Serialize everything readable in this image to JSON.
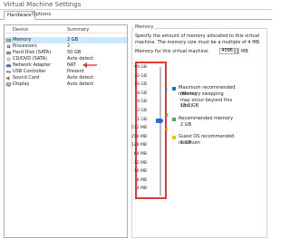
{
  "window": {
    "title": "Virtual Machine Settings"
  },
  "tabs": [
    {
      "label": "Hardware"
    },
    {
      "label": "Options"
    }
  ],
  "devices": {
    "header": {
      "device": "Device",
      "summary": "Summary"
    },
    "items": [
      {
        "name": "Memory",
        "summary": "2 GB",
        "icon": "memory-icon"
      },
      {
        "name": "Processors",
        "summary": "2",
        "icon": "processor-icon"
      },
      {
        "name": "Hard Disk (SATA)",
        "summary": "50 GB",
        "icon": "hard-disk-icon"
      },
      {
        "name": "CD/DVD (SATA)",
        "summary": "Auto detect",
        "icon": "cd-dvd-icon"
      },
      {
        "name": "Network Adapter",
        "summary": "NAT",
        "icon": "network-adapter-icon"
      },
      {
        "name": "USB Controller",
        "summary": "Present",
        "icon": "usb-icon"
      },
      {
        "name": "Sound Card",
        "summary": "Auto detect",
        "icon": "sound-card-icon"
      },
      {
        "name": "Display",
        "summary": "Auto detect",
        "icon": "display-icon"
      }
    ]
  },
  "memory": {
    "group_label": "Memory",
    "description": "Specify the amount of memory allocated to this virtual machine. The memory size must be a multiple of 4 MB.",
    "field_label": "Memory for this virtual machine:",
    "value": "4096",
    "unit": "MB",
    "slider_ticks": [
      "64 GB",
      "32 GB",
      "16 GB",
      "8 GB",
      "4 GB",
      "2 GB",
      "1 GB",
      "512 MB",
      "256 MB",
      "128 MB",
      "64 MB",
      "32 MB",
      "16 MB",
      "8 MB",
      "4 MB"
    ],
    "legend": {
      "max": {
        "label": "Maximum recommended memory",
        "note": "(Memory swapping may occur beyond this size.)",
        "value": "13.3 GB",
        "color": "#1479c9"
      },
      "recommended": {
        "label": "Recommended memory",
        "value": "2 GB",
        "color": "#4caf50"
      },
      "guest_min": {
        "label": "Guest OS recommended minimum",
        "value": "1 GB",
        "color": "#e5c600"
      }
    }
  },
  "colors": {
    "highlight": "#e53935",
    "selection": "#cce8ff"
  }
}
